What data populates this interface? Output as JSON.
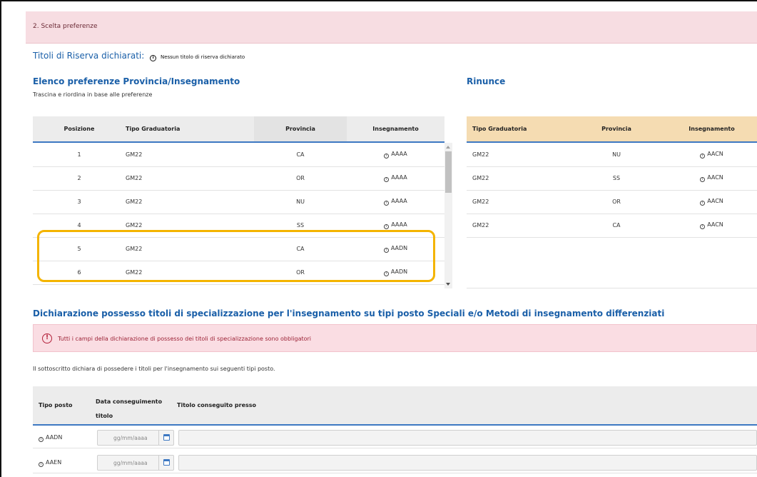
{
  "section": {
    "title": "2. Scelta preferenze"
  },
  "reserve": {
    "label": "Titoli di Riserva dichiarati:",
    "value": "Nessun titolo di riserva dichiarato"
  },
  "preferences": {
    "title": "Elenco preferenze Provincia/Insegnamento",
    "subtitle": "Trascina e riordina in base alle preferenze",
    "columns": [
      "Posizione",
      "Tipo Graduatoria",
      "Provincia",
      "Insegnamento"
    ],
    "rows": [
      {
        "pos": "1",
        "tipo": "GM22",
        "prov": "CA",
        "ins": "AAAA"
      },
      {
        "pos": "2",
        "tipo": "GM22",
        "prov": "OR",
        "ins": "AAAA"
      },
      {
        "pos": "3",
        "tipo": "GM22",
        "prov": "NU",
        "ins": "AAAA"
      },
      {
        "pos": "4",
        "tipo": "GM22",
        "prov": "SS",
        "ins": "AAAA"
      },
      {
        "pos": "5",
        "tipo": "GM22",
        "prov": "CA",
        "ins": "AADN"
      },
      {
        "pos": "6",
        "tipo": "GM22",
        "prov": "OR",
        "ins": "AADN"
      }
    ]
  },
  "rinunce": {
    "title": "Rinunce",
    "columns": [
      "Tipo Graduatoria",
      "Provincia",
      "Insegnamento"
    ],
    "rows": [
      {
        "tipo": "GM22",
        "prov": "NU",
        "ins": "AACN"
      },
      {
        "tipo": "GM22",
        "prov": "SS",
        "ins": "AACN"
      },
      {
        "tipo": "GM22",
        "prov": "OR",
        "ins": "AACN"
      },
      {
        "tipo": "GM22",
        "prov": "CA",
        "ins": "AACN"
      }
    ]
  },
  "declaration": {
    "title": "Dichiarazione possesso titoli di specializzazione per l'insegnamento su tipi posto Speciali e/o Metodi di insegnamento differenziati",
    "alert": "Tutti i campi della dichiarazione di possesso dei titoli di specializzazione sono obbligatori",
    "text": "Il sottoscritto dichiara di possedere i titoli per l'insegnamento sui seguenti tipi posto.",
    "columns": {
      "tipo": "Tipo posto",
      "data": "Data conseguimento titolo",
      "presso": "Titolo conseguito presso"
    },
    "rows": [
      {
        "tipo": "AADN",
        "date_placeholder": "gg/mm/aaaa"
      },
      {
        "tipo": "AAEN",
        "date_placeholder": "gg/mm/aaaa"
      }
    ]
  },
  "colors": {
    "accent": "#1a5fa8",
    "highlight": "#f4b400",
    "alert_bg": "#fadde3",
    "rinunce_header": "#f5dcb2"
  },
  "icons": {
    "info": "info-circle-icon",
    "calendar": "calendar-icon",
    "alert": "exclamation-circle-icon"
  }
}
